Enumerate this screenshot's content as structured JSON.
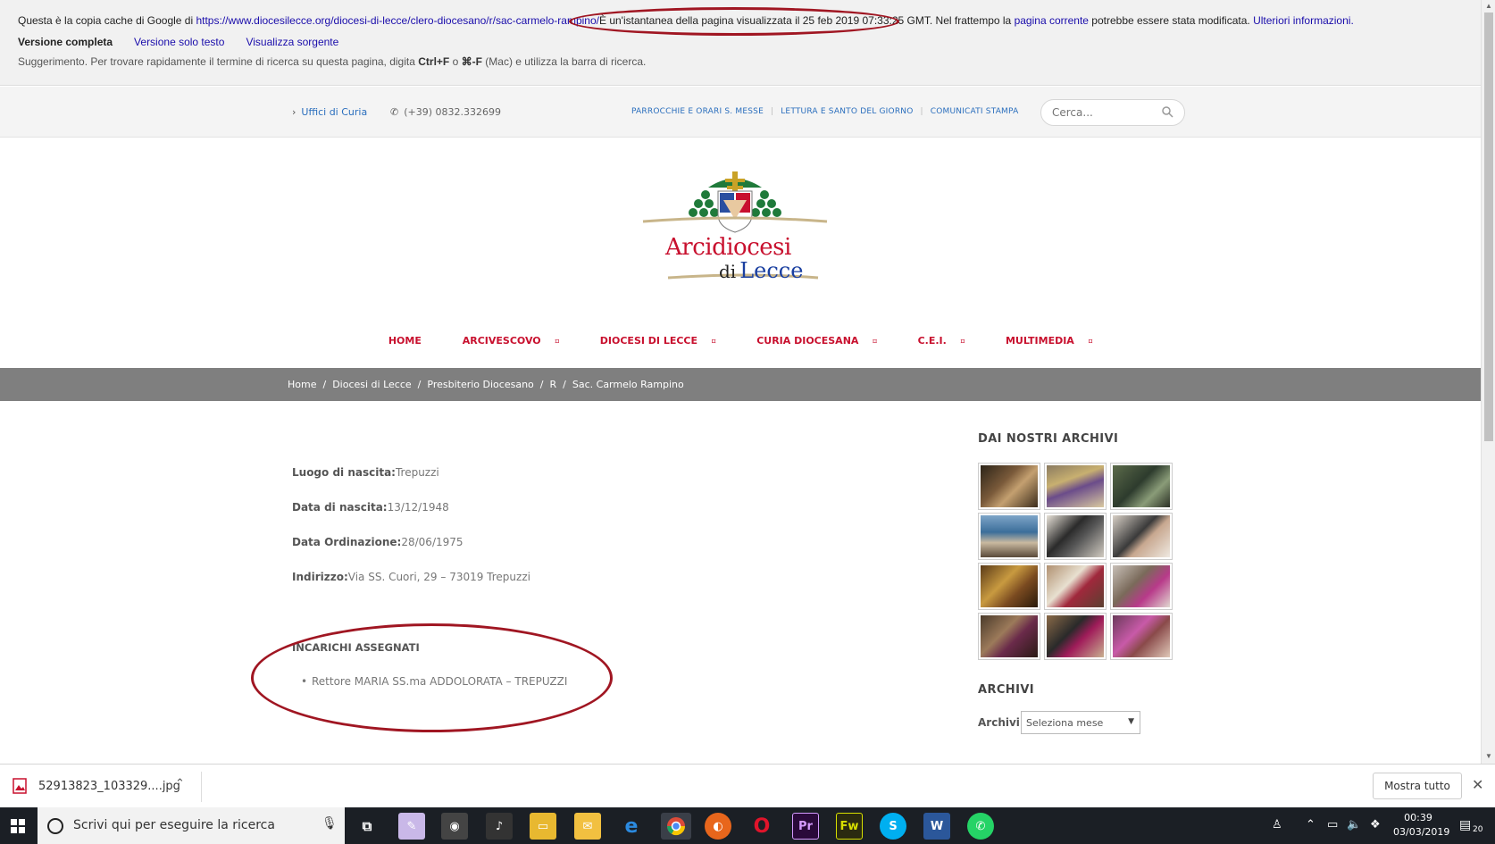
{
  "cache_banner": {
    "intro": "Questa è la copia cache di Google di ",
    "url": "https://www.diocesilecce.org/diocesi-di-lecce/clero-diocesano/r/sac-carmelo-rampino/",
    "snapshot": "È un'istantanea della pagina visualizzata il 25 feb 2019 07:33:25 GMT",
    "meanwhile": ". Nel frattempo la ",
    "current_page": "pagina corrente",
    "modified": " potrebbe essere stata modificata. ",
    "more_info": "Ulteriori informazioni.",
    "full_version": "Versione completa",
    "text_only": "Versione solo testo",
    "view_source": "Visualizza sorgente",
    "tip_prefix": "Suggerimento. Per trovare rapidamente il termine di ricerca su questa pagina, digita ",
    "tip_key1": "Ctrl+F",
    "tip_mid": " o ",
    "tip_key2": "⌘-F",
    "tip_suffix": " (Mac) e utilizza la barra di ricerca."
  },
  "topbar": {
    "uffici": "Uffici di Curia",
    "phone": "(+39) 0832.332699",
    "menu": [
      "PARROCCHIE E ORARI S. MESSE",
      "LETTURA E SANTO DEL GIORNO",
      "COMUNICATI STAMPA"
    ],
    "search_placeholder": "Cerca..."
  },
  "logo": {
    "line1": "Arcidiocesi",
    "di": "di",
    "line2": "Lecce"
  },
  "nav": [
    "HOME",
    "ARCIVESCOVO",
    "DIOCESI DI LECCE",
    "CURIA DIOCESANA",
    "C.E.I.",
    "MULTIMEDIA"
  ],
  "breadcrumb": [
    "Home",
    "Diocesi di Lecce",
    "Presbiterio Diocesano",
    "R",
    "Sac. Carmelo Rampino"
  ],
  "profile": {
    "birthplace_label": "Luogo di nascita:",
    "birthplace": "Trepuzzi",
    "birthdate_label": "Data di nascita:",
    "birthdate": "13/12/1948",
    "ordination_label": "Data Ordinazione:",
    "ordination": "28/06/1975",
    "address_label": "Indirizzo:",
    "address": "Via SS. Cuori, 29 – 73019 Trepuzzi",
    "assignments_title": "INCARICHI ASSEGNATI",
    "assignments": [
      "Rettore MARIA SS.ma ADDOLORATA – TREPUZZI"
    ]
  },
  "sidebar": {
    "archive_photos_title": "DAI NOSTRI ARCHIVI",
    "archives_title": "ARCHIVI",
    "archives_label": "Archivi",
    "archives_select": "Seleziona mese"
  },
  "download_bar": {
    "file": "52913823_103329....jpg",
    "show_all": "Mostra tutto"
  },
  "taskbar": {
    "search": "Scrivi qui per eseguire la ricerca",
    "time": "00:39",
    "date": "03/03/2019",
    "notifications": "20"
  },
  "colors": {
    "accent_red": "#c8102e",
    "link_blue": "#2a6ebd",
    "breadcrumb_bg": "#7f7f7f",
    "annotation": "#a01622"
  }
}
